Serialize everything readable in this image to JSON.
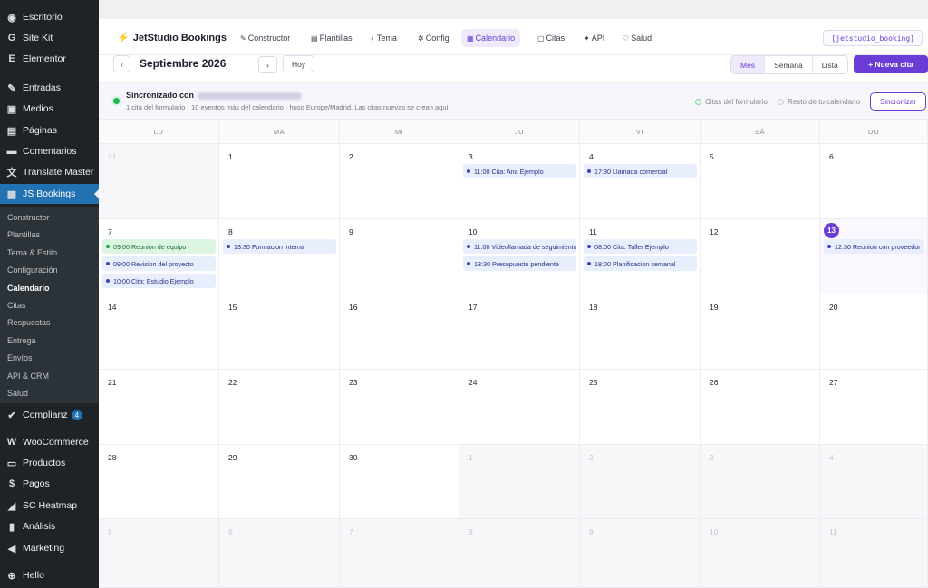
{
  "sidebar": {
    "items": [
      {
        "icon": "dashboard-icon",
        "glyph": "◉",
        "label": "Escritorio",
        "name": "sidebar-item-escritorio"
      },
      {
        "icon": "sitekit-icon",
        "glyph": "G",
        "label": "Site Kit",
        "name": "sidebar-item-sitekit"
      },
      {
        "icon": "elementor-icon",
        "glyph": "E",
        "label": "Elementor",
        "name": "sidebar-item-elementor"
      },
      {
        "icon": "pin-icon",
        "glyph": "✎",
        "label": "Entradas",
        "name": "sidebar-item-entradas"
      },
      {
        "icon": "media-icon",
        "glyph": "▣",
        "label": "Medios",
        "name": "sidebar-item-medios"
      },
      {
        "icon": "pages-icon",
        "glyph": "▤",
        "label": "Páginas",
        "name": "sidebar-item-paginas"
      },
      {
        "icon": "comments-icon",
        "glyph": "▬",
        "label": "Comentarios",
        "name": "sidebar-item-comentarios"
      },
      {
        "icon": "translate-icon",
        "glyph": "文",
        "label": "Translate Master",
        "name": "sidebar-item-translate"
      },
      {
        "icon": "grid-icon",
        "glyph": "▦",
        "label": "JS Bookings",
        "name": "sidebar-item-jsbookings",
        "active": true
      }
    ],
    "submenu": [
      {
        "label": "Constructor"
      },
      {
        "label": "Plantillas"
      },
      {
        "label": "Tema & Estilo"
      },
      {
        "label": "Configuración"
      },
      {
        "label": "Calendario",
        "current": true
      },
      {
        "label": "Citas"
      },
      {
        "label": "Respuestas"
      },
      {
        "label": "Entrega"
      },
      {
        "label": "Envíos"
      },
      {
        "label": "API & CRM"
      },
      {
        "label": "Salud"
      }
    ],
    "items2": [
      {
        "icon": "check-icon",
        "glyph": "✔",
        "label": "Complianz",
        "badge": "4",
        "name": "sidebar-item-complianz"
      },
      {
        "icon": "woocommerce-icon",
        "glyph": "W",
        "label": "WooCommerce",
        "name": "sidebar-item-woocommerce"
      },
      {
        "icon": "products-icon",
        "glyph": "▭",
        "label": "Productos",
        "name": "sidebar-item-productos"
      },
      {
        "icon": "payments-icon",
        "glyph": "$",
        "label": "Pagos",
        "name": "sidebar-item-pagos"
      },
      {
        "icon": "heatmap-icon",
        "glyph": "◢",
        "label": "SC Heatmap",
        "name": "sidebar-item-heatmap"
      },
      {
        "icon": "analytics-icon",
        "glyph": "▮",
        "label": "Análisis",
        "name": "sidebar-item-analisis"
      },
      {
        "icon": "megaphone-icon",
        "glyph": "◀",
        "label": "Marketing",
        "name": "sidebar-item-marketing"
      },
      {
        "icon": "plus-circle-icon",
        "glyph": "⊕",
        "label": "Hello",
        "name": "sidebar-item-hello"
      }
    ]
  },
  "header": {
    "brand": "JetStudio Bookings",
    "tabs": [
      {
        "icon": "✎",
        "label": "Constructor"
      },
      {
        "icon": "▤",
        "label": "Plantillas"
      },
      {
        "icon": "◐",
        "label": "Tema"
      },
      {
        "icon": "✲",
        "label": "Config"
      },
      {
        "icon": "▦",
        "label": "Calendario",
        "active": true
      },
      {
        "icon": "▢",
        "label": "Citas"
      },
      {
        "icon": "✦",
        "label": "API"
      },
      {
        "icon": "♡",
        "label": "Salud"
      }
    ],
    "shortcode": "[jetstudio_booking]"
  },
  "toolbar": {
    "prev": "‹",
    "month": "Septiembre 2026",
    "next": "›",
    "today": "Hoy",
    "views": [
      {
        "label": "Mes",
        "active": true
      },
      {
        "label": "Semana"
      },
      {
        "label": "Lista"
      }
    ],
    "new_button": "+ Nueva cita"
  },
  "sync": {
    "title": "Sincronizado con",
    "subtitle": "1 cita del formulario · 10 eventos más del calendario · huso Europe/Madrid. Las citas nuevas se crean aquí.",
    "legend_form": "Citas del formulario",
    "legend_rest": "Resto de tu calendario",
    "button": "Sincronizar"
  },
  "calendar": {
    "weekdays": [
      "LU",
      "MA",
      "MI",
      "JU",
      "VI",
      "SÁ",
      "DO"
    ],
    "weeks": [
      [
        {
          "day": "31",
          "other": true
        },
        {
          "day": "1"
        },
        {
          "day": "2"
        },
        {
          "day": "3",
          "events": [
            {
              "text": "11:00 Cita: Ana Ejemplo"
            }
          ]
        },
        {
          "day": "4",
          "events": [
            {
              "text": "17:30 Llamada comercial"
            }
          ]
        },
        {
          "day": "5"
        },
        {
          "day": "6"
        }
      ],
      [
        {
          "day": "7",
          "events": [
            {
              "text": "09:00 Reunion de equipo",
              "green": true
            },
            {
              "text": "09:00 Revision del proyecto"
            },
            {
              "text": "10:00 Cita: Estudio Ejemplo"
            }
          ]
        },
        {
          "day": "8",
          "events": [
            {
              "text": "13:30 Formacion interna"
            }
          ]
        },
        {
          "day": "9"
        },
        {
          "day": "10",
          "events": [
            {
              "text": "11:00 Videollamada de seguimiento"
            },
            {
              "text": "13:30 Presupuesto pendiente"
            }
          ]
        },
        {
          "day": "11",
          "events": [
            {
              "text": "08:00 Cita: Taller Ejemplo"
            },
            {
              "text": "18:00 Planificacion semanal"
            }
          ]
        },
        {
          "day": "12"
        },
        {
          "day": "13",
          "today": true,
          "events": [
            {
              "text": "12:30 Reunion con proveedor"
            }
          ]
        }
      ],
      [
        {
          "day": "14"
        },
        {
          "day": "15"
        },
        {
          "day": "16"
        },
        {
          "day": "17"
        },
        {
          "day": "18"
        },
        {
          "day": "19"
        },
        {
          "day": "20"
        }
      ],
      [
        {
          "day": "21"
        },
        {
          "day": "22"
        },
        {
          "day": "23"
        },
        {
          "day": "24"
        },
        {
          "day": "25"
        },
        {
          "day": "26"
        },
        {
          "day": "27"
        }
      ],
      [
        {
          "day": "28"
        },
        {
          "day": "29"
        },
        {
          "day": "30"
        },
        {
          "day": "1",
          "other": true
        },
        {
          "day": "2",
          "other": true
        },
        {
          "day": "3",
          "other": true
        },
        {
          "day": "4",
          "other": true
        }
      ],
      [
        {
          "day": "5",
          "other": true
        },
        {
          "day": "6",
          "other": true
        },
        {
          "day": "7",
          "other": true
        },
        {
          "day": "8",
          "other": true
        },
        {
          "day": "9",
          "other": true
        },
        {
          "day": "10",
          "other": true
        },
        {
          "day": "11",
          "other": true
        }
      ]
    ]
  },
  "colors": {
    "accent": "#6a3ed6",
    "wp_sidebar": "#1d2327",
    "wp_active": "#2271b1",
    "sync_green": "#22b55a"
  }
}
